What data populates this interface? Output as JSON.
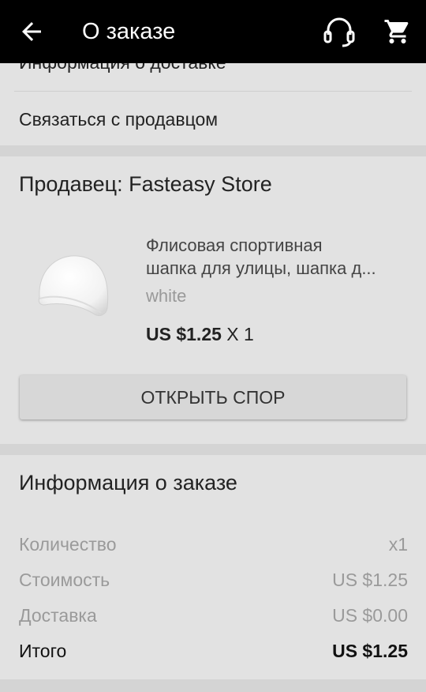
{
  "app_bar": {
    "title": "О заказе",
    "icons": {
      "back": "arrow-left-icon",
      "support": "headset-icon",
      "cart": "cart-icon"
    }
  },
  "links": {
    "delivery_info": "Информация о доставке",
    "contact_seller": "Связаться с продавцом"
  },
  "seller_section": {
    "seller_label": "Продавец: Fasteasy Store",
    "product": {
      "title_line1": "Флисовая спортивная",
      "title_line2": "шапка для улицы, шапка д...",
      "variant": "white",
      "price": "US $1.25",
      "quantity": "X 1"
    },
    "dispute_button": "ОТКРЫТЬ СПОР"
  },
  "order_info": {
    "title": "Информация о заказе",
    "rows": [
      {
        "label": "Количество",
        "value": "x1"
      },
      {
        "label": "Стоимость",
        "value": "US $1.25"
      },
      {
        "label": "Доставка",
        "value": "US $0.00"
      },
      {
        "label": "Итого",
        "value": "US $1.25"
      }
    ]
  }
}
